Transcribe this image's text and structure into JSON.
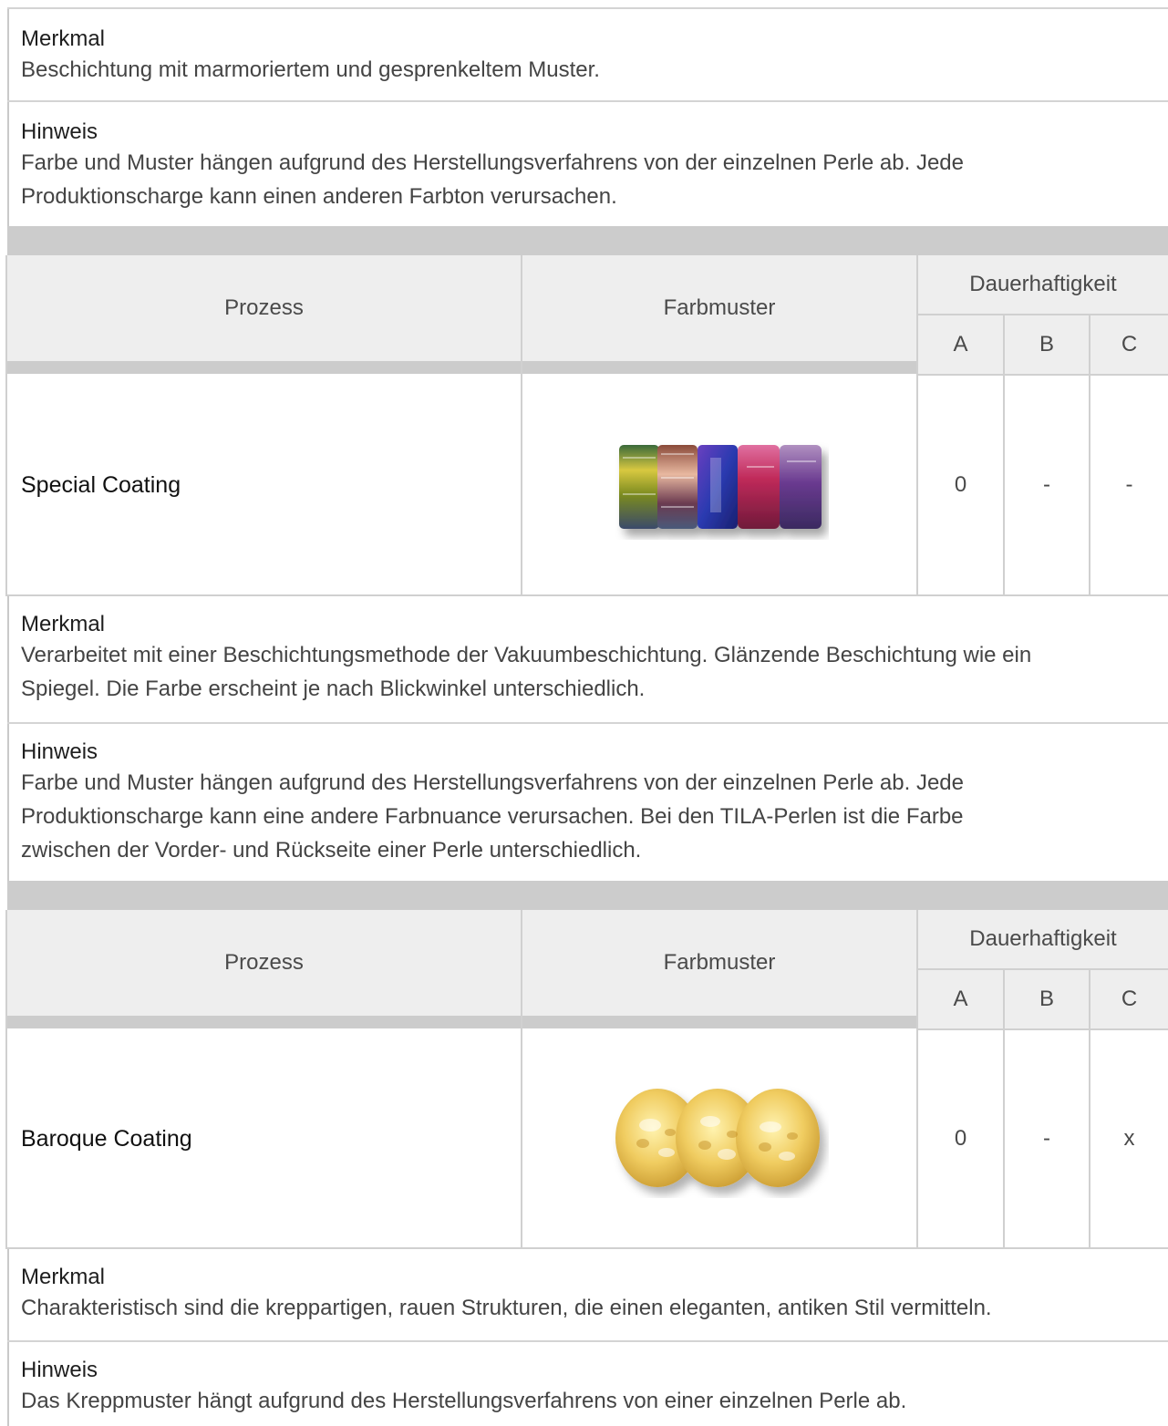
{
  "blocks": {
    "merkmal1": {
      "heading": "Merkmal",
      "text": "Beschichtung mit marmoriertem und gesprenkeltem Muster."
    },
    "hinweis1": {
      "heading": "Hinweis",
      "line1": "Farbe und Muster hängen aufgrund des Herstellungsverfahrens von der einzelnen Perle ab. Jede",
      "line2": "Produktionscharge kann einen anderen Farbton verursachen."
    },
    "table1": {
      "col_process": "Prozess",
      "col_sample": "Farbmuster",
      "col_durability": "Dauerhaftigkeit",
      "col_a": "A",
      "col_b": "B",
      "col_c": "C",
      "process": "Special Coating",
      "a": "0",
      "b": "-",
      "c": "-"
    },
    "merkmal2": {
      "heading": "Merkmal",
      "line1": "Verarbeitet mit einer Beschichtungsmethode der Vakuumbeschichtung. Glänzende Beschichtung wie ein",
      "line2": "Spiegel. Die Farbe erscheint je nach Blickwinkel unterschiedlich."
    },
    "hinweis2": {
      "heading": "Hinweis",
      "line1": "Farbe und Muster hängen aufgrund des Herstellungsverfahrens von der einzelnen Perle ab. Jede",
      "line2": "Produktionscharge kann eine andere Farbnuance verursachen. Bei den TILA-Perlen ist die Farbe",
      "line3": "zwischen der Vorder- und Rückseite einer Perle unterschiedlich."
    },
    "table2": {
      "col_process": "Prozess",
      "col_sample": "Farbmuster",
      "col_durability": "Dauerhaftigkeit",
      "col_a": "A",
      "col_b": "B",
      "col_c": "C",
      "process": "Baroque Coating",
      "a": "0",
      "b": "-",
      "c": "x"
    },
    "merkmal3": {
      "heading": "Merkmal",
      "text": "Charakteristisch sind die kreppartigen, rauen Strukturen, die einen eleganten, antiken Stil vermitteln."
    },
    "hinweis3": {
      "heading": "Hinweis",
      "text": "Das Kreppmuster hängt aufgrund des Herstellungsverfahrens von einer einzelnen Perle ab."
    }
  },
  "images": {
    "special_coating": "multicolor-metallic-beads",
    "baroque_coating": "gold-textured-beads"
  }
}
